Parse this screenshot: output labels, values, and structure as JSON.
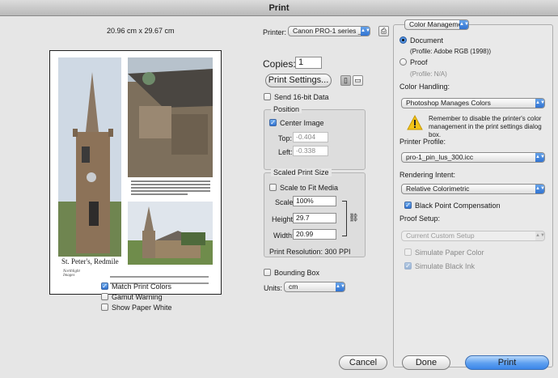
{
  "window": {
    "title": "Print"
  },
  "preview": {
    "paper_size": "20.96 cm x 29.67 cm",
    "caption_title": "St. Peter's, Redmile",
    "logo_text": "Northlight Images",
    "blurb": "Detail from full resolution image, showing cracks and mortar repair work. Full resolution rectified image to be 6ft measured ~41,000 x 24,000 pixels. Image below exposure to your 2000 megapixel equivalent - and beyond large format film, with a faster turnaround and at low cost",
    "footer": "High resolution specialist architectural photography by Keith Cooper of Northlight Images Leicester.\nTel: 0116 291 9092   Email: kc@northlight-images.co.uk   http://www.northlight-images.co.uk",
    "match_print_colors": "Match Print Colors",
    "gamut_warning": "Gamut Warning",
    "show_paper_white": "Show Paper White"
  },
  "printer": {
    "label": "Printer:",
    "value": "Canon PRO-1 series _0..."
  },
  "copies": {
    "label": "Copies:",
    "value": "1"
  },
  "print_settings_button": "Print Settings...",
  "send16": "Send 16-bit Data",
  "position": {
    "title": "Position",
    "center_image": "Center Image",
    "top_label": "Top:",
    "top_value": "-0.404",
    "left_label": "Left:",
    "left_value": "-0.338"
  },
  "scaled": {
    "title": "Scaled Print Size",
    "scale_to_fit": "Scale to Fit Media",
    "scale_label": "Scale:",
    "scale_value": "100%",
    "height_label": "Height:",
    "height_value": "29.7",
    "width_label": "Width:",
    "width_value": "20.99",
    "resolution": "Print Resolution: 300 PPI"
  },
  "bounding_box": "Bounding Box",
  "units": {
    "label": "Units:",
    "value": "cm"
  },
  "color_mgmt": {
    "menu": "Color Management",
    "document": "Document",
    "document_profile": "(Profile: Adobe RGB (1998))",
    "proof": "Proof",
    "proof_profile": "(Profile: N/A)",
    "handling_label": "Color Handling:",
    "handling_value": "Photoshop Manages Colors",
    "warning": "Remember to disable the printer's color management in the print settings dialog box.",
    "profile_label": "Printer Profile:",
    "profile_value": "pro-1_pin_lus_300.icc",
    "intent_label": "Rendering Intent:",
    "intent_value": "Relative Colorimetric",
    "bpc": "Black Point Compensation",
    "proof_setup_label": "Proof Setup:",
    "proof_setup_value": "Current Custom Setup",
    "sim_paper": "Simulate Paper Color",
    "sim_black": "Simulate Black Ink"
  },
  "buttons": {
    "cancel": "Cancel",
    "done": "Done",
    "print": "Print"
  },
  "colors": {
    "accent": "#3c86e8",
    "warning": "#f2c318"
  }
}
